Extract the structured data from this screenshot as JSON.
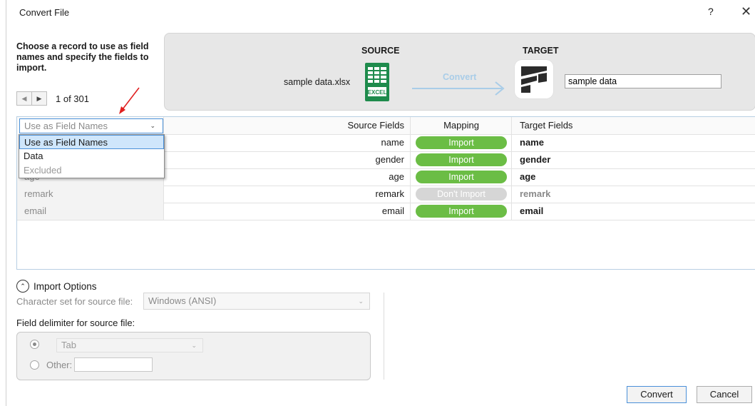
{
  "window": {
    "title": "Convert File",
    "help_label": "?",
    "close_label": "✕"
  },
  "instruction": "Choose a record to use as field names and specify the fields to import.",
  "record_nav": {
    "count_label": "1 of 301"
  },
  "banner": {
    "source_label": "SOURCE",
    "target_label": "TARGET",
    "source_file": "sample data.xlsx",
    "excel_badge": "EXCEL",
    "convert_label": "Convert",
    "target_name": "sample data"
  },
  "grid": {
    "combo_value": "Use as Field Names",
    "headers": {
      "source": "Source Fields",
      "mapping": "Mapping",
      "target": "Target Fields"
    },
    "rows": [
      {
        "left": "",
        "source": "name",
        "mapping": "Import",
        "target": "name"
      },
      {
        "left": "",
        "source": "gender",
        "mapping": "Import",
        "target": "gender"
      },
      {
        "left": "age",
        "source": "age",
        "mapping": "Import",
        "target": "age"
      },
      {
        "left": "remark",
        "source": "remark",
        "mapping": "Don't Import",
        "target": "remark"
      },
      {
        "left": "email",
        "source": "email",
        "mapping": "Import",
        "target": "email"
      }
    ]
  },
  "dropdown": {
    "options": [
      "Use as Field Names",
      "Data",
      "Excluded"
    ]
  },
  "import_options": {
    "toggle_label": "Import Options",
    "charset_label": "Character set for source file:",
    "charset_value": "Windows (ANSI)",
    "delimiter_label": "Field delimiter for source file:",
    "tab_option": "Tab",
    "other_label": "Other:",
    "other_value": ""
  },
  "buttons": {
    "convert": "Convert",
    "cancel": "Cancel"
  },
  "colors": {
    "import_green": "#6bbd45",
    "dont_import_gray": "#d6d6d6",
    "accent_blue": "#4a90d9",
    "arrow_red": "#e02020"
  }
}
